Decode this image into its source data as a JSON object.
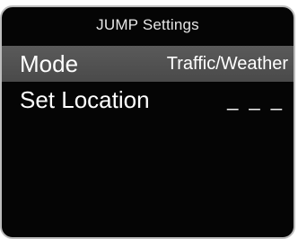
{
  "screen": {
    "title": "JUMP Settings"
  },
  "menu": {
    "items": [
      {
        "label": "Mode",
        "value": "Traffic/Weather",
        "selected": true
      },
      {
        "label": "Set Location",
        "value": "_ _ _",
        "selected": false
      }
    ]
  },
  "colors": {
    "background": "#050505",
    "selected_row": "#555555",
    "text": "#ffffff",
    "bezel": "#bdbdbd"
  }
}
